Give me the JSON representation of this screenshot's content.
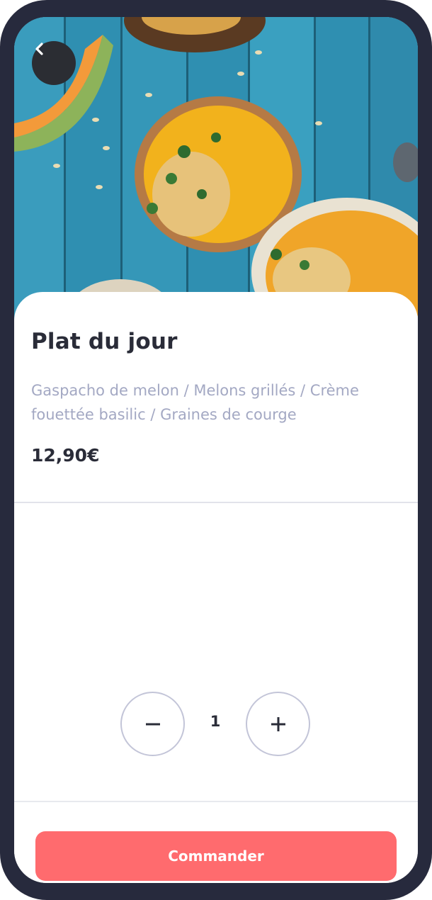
{
  "hero": {
    "back_icon": "chevron-left-icon"
  },
  "dish": {
    "title": "Plat du jour",
    "description": "Gaspacho de melon / Melons grillés / Crème fouettée basilic / Graines de courge",
    "price": "12,90€"
  },
  "quantity": {
    "minus_icon": "minus-icon",
    "value": "1",
    "plus_icon": "plus-icon"
  },
  "order": {
    "label": "Commander"
  },
  "colors": {
    "frame": "#272a3d",
    "accent": "#ff6b6e",
    "title_text": "#2a2c38",
    "description_text": "#a3a8c3",
    "stepper_border": "#c3c5d8"
  }
}
